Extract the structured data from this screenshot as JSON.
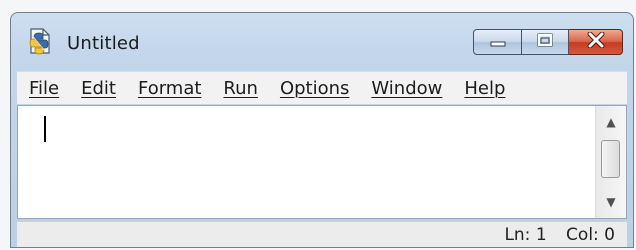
{
  "window": {
    "title": "Untitled",
    "icon": "python-idle-icon"
  },
  "caption_buttons": [
    {
      "name": "minimize",
      "icon": "minimize-icon"
    },
    {
      "name": "maximize",
      "icon": "maximize-icon"
    },
    {
      "name": "close",
      "icon": "close-icon"
    }
  ],
  "menubar": {
    "items": [
      {
        "label": "File"
      },
      {
        "label": "Edit"
      },
      {
        "label": "Format"
      },
      {
        "label": "Run"
      },
      {
        "label": "Options"
      },
      {
        "label": "Window"
      },
      {
        "label": "Help"
      }
    ]
  },
  "editor": {
    "content": ""
  },
  "statusbar": {
    "line": "Ln: 1",
    "col": "Col: 0"
  },
  "colors": {
    "title_gradient_top": "#cfdff0",
    "close_button": "#c43b21",
    "editor_bg": "#ffffff"
  }
}
